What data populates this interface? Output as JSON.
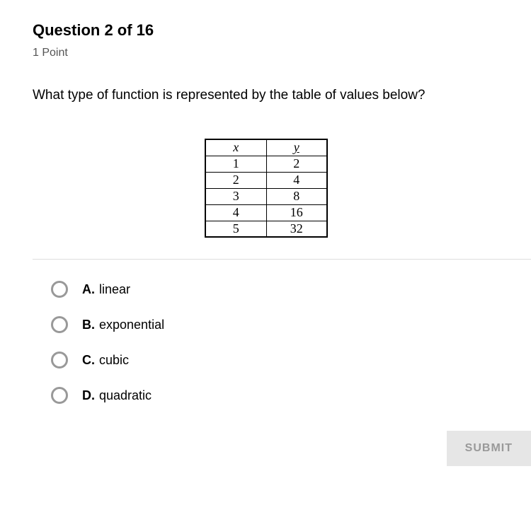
{
  "header": {
    "title": "Question 2 of 16",
    "points": "1 Point"
  },
  "question": {
    "text": "What type of function is represented by the table of values below?"
  },
  "chart_data": {
    "type": "table",
    "columns": [
      "x",
      "y"
    ],
    "rows": [
      {
        "x": "1",
        "y": "2"
      },
      {
        "x": "2",
        "y": "4"
      },
      {
        "x": "3",
        "y": "8"
      },
      {
        "x": "4",
        "y": "16"
      },
      {
        "x": "5",
        "y": "32"
      }
    ]
  },
  "options": [
    {
      "letter": "A.",
      "text": "linear"
    },
    {
      "letter": "B.",
      "text": "exponential"
    },
    {
      "letter": "C.",
      "text": "cubic"
    },
    {
      "letter": "D.",
      "text": "quadratic"
    }
  ],
  "buttons": {
    "submit": "SUBMIT"
  }
}
